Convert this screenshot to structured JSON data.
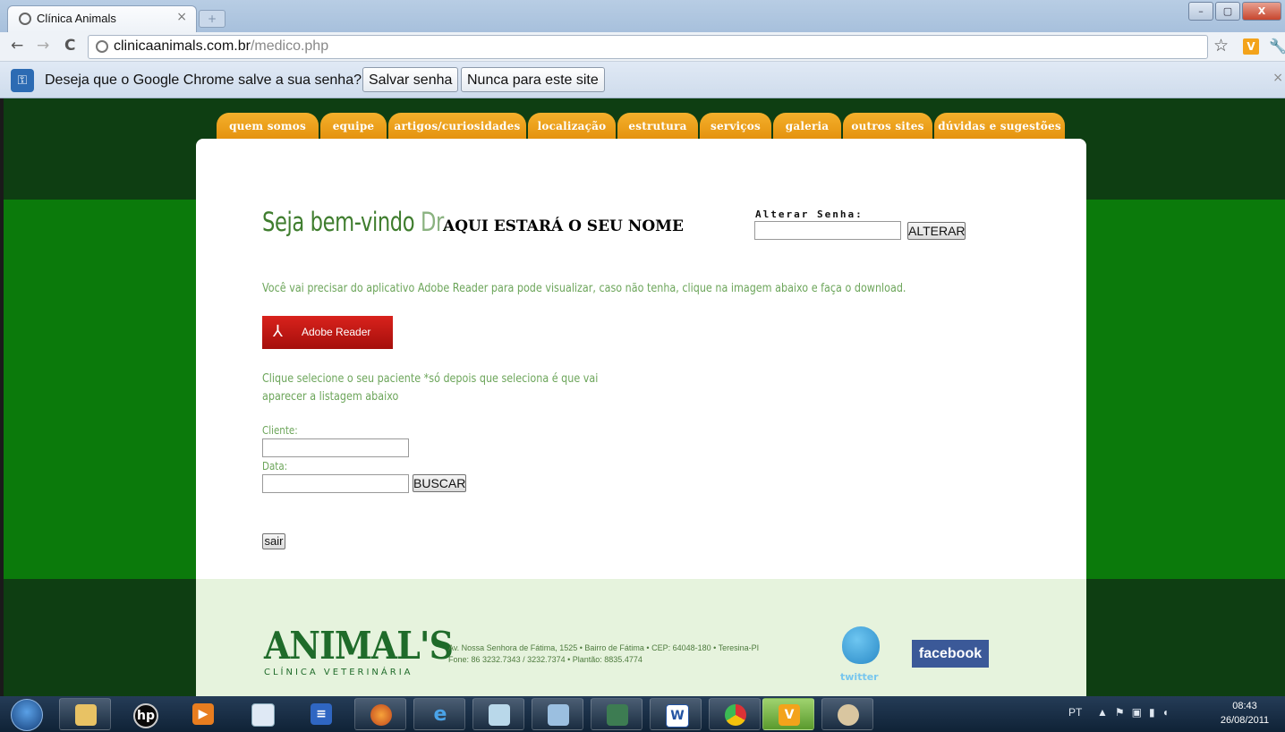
{
  "browser": {
    "tab_title": "Clínica Animals",
    "tab_close": "×",
    "new_tab": "+",
    "url_host": "clinicaanimals.com.br",
    "url_path": "/medico.php",
    "nav_back": "←",
    "nav_forward": "→",
    "nav_reload": "C",
    "bookmark": "☆",
    "extension": "V",
    "wrench": "🔧",
    "window_controls": {
      "minimize": "–",
      "restore": "▢",
      "close": "X"
    }
  },
  "infobar": {
    "message": "Deseja que o Google Chrome salve a sua senha?",
    "save_label": "Salvar senha",
    "never_label": "Nunca para este site",
    "close": "×"
  },
  "menu": {
    "items": [
      "quem somos",
      "equipe",
      "artigos/curiosidades",
      "localização",
      "estrutura",
      "serviços",
      "galeria",
      "outros sites",
      "dúvidas e sugestões"
    ]
  },
  "content": {
    "welcome": "Seja bem-vindo",
    "dr": "Dr.",
    "user_name": "AQUI ESTARÁ O SEU NOME",
    "change_password_label": "Alterar Senha:",
    "change_password_value": "",
    "alter_button": "ALTERAR",
    "adobe_info": "Você vai precisar do aplicativo Adobe Reader para pode visualizar, caso não tenha, clique na imagem abaixo e faça o download.",
    "adobe_button": "Adobe Reader",
    "select_patient_info": "Clique selecione o seu paciente *só depois que seleciona é que vai aparecer a listagem abaixo",
    "client_label": "Cliente:",
    "client_value": "",
    "date_label": "Data:",
    "date_value": "",
    "search_button": "BUSCAR",
    "logout_button": "sair"
  },
  "footer": {
    "brand": "ANIMAL'S",
    "brand_sub": "CLÍNICA VETERINÁRIA",
    "address_line1": "Av. Nossa Senhora de Fátima, 1525 • Bairro de Fátima • CEP: 64048-180 • Teresina-PI",
    "address_line2": "Fone: 86 3232.7343 / 3232.7374 • Plantão: 8835.4774",
    "twitter_label": "twitter",
    "facebook_label": "facebook"
  },
  "taskbar": {
    "language": "PT",
    "time": "08:43",
    "date": "26/08/2011",
    "apps": [
      "file-explorer",
      "hp",
      "media-player",
      "window",
      "taskbar-app",
      "firefox",
      "internet-explorer",
      "notepad",
      "control-panel",
      "system-monitor",
      "word",
      "chrome",
      "vivaldi",
      "paint"
    ]
  },
  "colors": {
    "site_green": "#0b7a0b",
    "dark_green": "#0e3e12",
    "menu_orange": "#f0a020",
    "text_green": "#6ca55a",
    "adobe_red": "#c4161c",
    "facebook_blue": "#3b5998"
  }
}
